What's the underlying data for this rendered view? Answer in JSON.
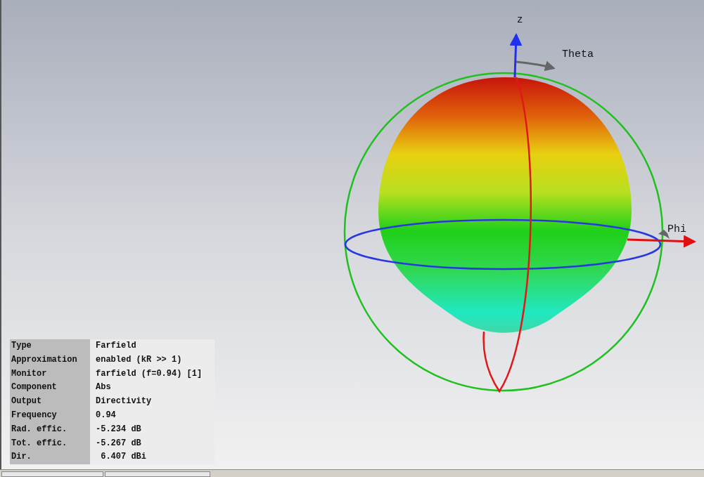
{
  "plot": {
    "axis_labels": {
      "z": "z",
      "theta": "Theta",
      "phi": "Phi"
    }
  },
  "info_table": [
    {
      "label": "Type",
      "value": "Farfield"
    },
    {
      "label": "Approximation",
      "value": "enabled (kR >> 1)"
    },
    {
      "label": "Monitor",
      "value": "farfield (f=0.94) [1]"
    },
    {
      "label": "Component",
      "value": "Abs"
    },
    {
      "label": "Output",
      "value": "Directivity"
    },
    {
      "label": "Frequency",
      "value": "0.94"
    },
    {
      "label": "Rad. effic.",
      "value": "-5.234 dB"
    },
    {
      "label": "Tot. effic.",
      "value": "-5.267 dB"
    },
    {
      "label": "Dir.",
      "value": " 6.407 dBi"
    }
  ]
}
